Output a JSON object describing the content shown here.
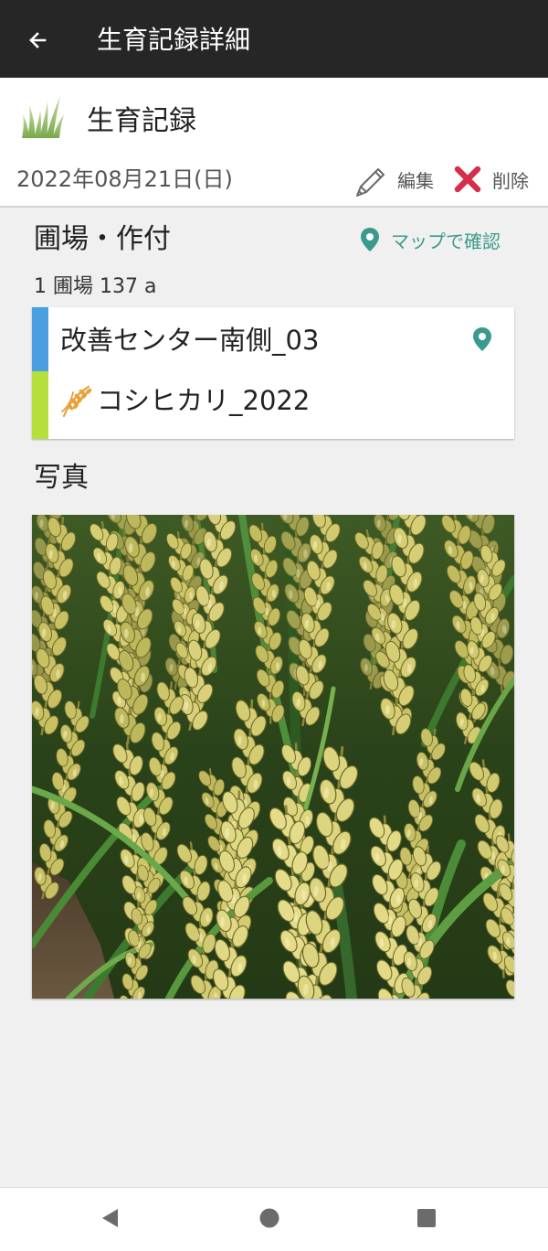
{
  "app_bar": {
    "title": "生育記録詳細",
    "back_icon": "arrow-back-icon"
  },
  "record": {
    "icon": "grass-icon",
    "title": "生育記録",
    "date": "2022年08月21日(日)",
    "edit": {
      "label": "編集",
      "icon": "pencil-icon"
    },
    "delete": {
      "label": "削除",
      "icon": "close-icon",
      "color": "#D62E4A"
    }
  },
  "field_section": {
    "heading": "圃場・作付",
    "map_link": {
      "label": "マップで確認",
      "icon": "map-pin-icon"
    },
    "summary": "1 圃場 137 a",
    "field": {
      "name": "改善センター南側_03",
      "color": "#4A9FE0",
      "icon": "map-pin-icon"
    },
    "crop": {
      "name": "コシヒカリ_2022",
      "color": "#B5E03C",
      "icon": "rice-icon"
    }
  },
  "photo_section": {
    "heading": "写真"
  },
  "nav_bar": {
    "back_icon": "nav-back-icon",
    "home_icon": "nav-home-icon",
    "recents_icon": "nav-recents-icon"
  },
  "colors": {
    "app_bar": "#262626",
    "background": "#F0F0F0",
    "accent": "#3A9A8C",
    "crop_icon": "#E9A23B"
  }
}
